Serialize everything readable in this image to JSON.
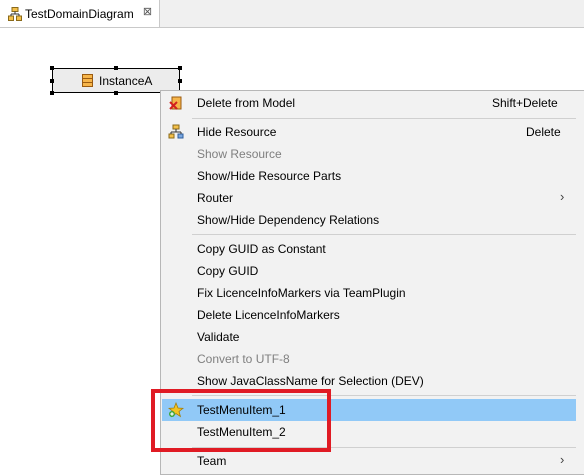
{
  "tab": {
    "title": "TestDomainDiagram",
    "close_glyph": "⊠",
    "icon": "diagram-icon"
  },
  "diagram": {
    "node_label": "InstanceA",
    "node_icon": "class-icon"
  },
  "context_menu": {
    "items": [
      {
        "label": "Delete from Model",
        "shortcut": "Shift+Delete",
        "icon": "delete-model-icon",
        "enabled": true
      },
      {
        "label": "Hide Resource",
        "shortcut": "Delete",
        "icon": "hide-resource-icon",
        "enabled": true
      },
      {
        "label": "Show Resource",
        "enabled": false
      },
      {
        "label": "Show/Hide Resource Parts",
        "enabled": true
      },
      {
        "label": "Router",
        "submenu": true,
        "enabled": true
      },
      {
        "label": "Show/Hide Dependency Relations",
        "enabled": true
      },
      {
        "label": "Copy GUID as Constant",
        "enabled": true
      },
      {
        "label": "Copy GUID",
        "enabled": true
      },
      {
        "label": "Fix LicenceInfoMarkers via TeamPlugin",
        "enabled": true
      },
      {
        "label": "Delete LicenceInfoMarkers",
        "enabled": true
      },
      {
        "label": "Validate",
        "enabled": true
      },
      {
        "label": "Convert to UTF-8",
        "enabled": false
      },
      {
        "label": "Show JavaClassName for Selection (DEV)",
        "enabled": true
      },
      {
        "label": "TestMenuItem_1",
        "icon": "star-add-icon",
        "enabled": true,
        "highlighted": true
      },
      {
        "label": "TestMenuItem_2",
        "enabled": true
      },
      {
        "label": "Team",
        "submenu": true,
        "enabled": true
      }
    ],
    "submenu_arrow": "›"
  },
  "colors": {
    "highlight": "#91c9f7",
    "annotation": "#e01b24",
    "menu_bg": "#f2f2f2"
  }
}
